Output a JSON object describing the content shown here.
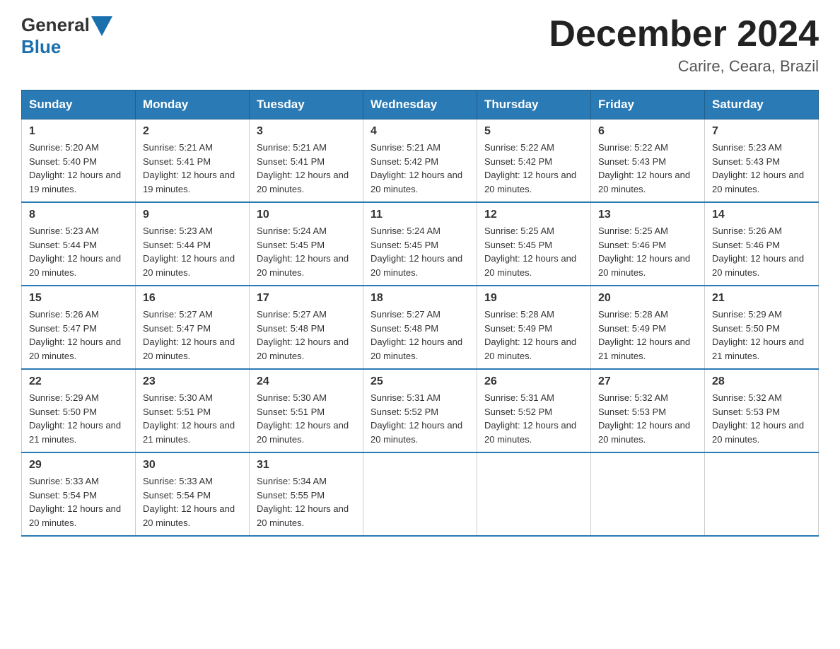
{
  "header": {
    "logo_general": "General",
    "logo_blue": "Blue",
    "month_title": "December 2024",
    "location": "Carire, Ceara, Brazil"
  },
  "days_of_week": [
    "Sunday",
    "Monday",
    "Tuesday",
    "Wednesday",
    "Thursday",
    "Friday",
    "Saturday"
  ],
  "weeks": [
    [
      {
        "day": "1",
        "sunrise": "5:20 AM",
        "sunset": "5:40 PM",
        "daylight": "12 hours and 19 minutes."
      },
      {
        "day": "2",
        "sunrise": "5:21 AM",
        "sunset": "5:41 PM",
        "daylight": "12 hours and 19 minutes."
      },
      {
        "day": "3",
        "sunrise": "5:21 AM",
        "sunset": "5:41 PM",
        "daylight": "12 hours and 20 minutes."
      },
      {
        "day": "4",
        "sunrise": "5:21 AM",
        "sunset": "5:42 PM",
        "daylight": "12 hours and 20 minutes."
      },
      {
        "day": "5",
        "sunrise": "5:22 AM",
        "sunset": "5:42 PM",
        "daylight": "12 hours and 20 minutes."
      },
      {
        "day": "6",
        "sunrise": "5:22 AM",
        "sunset": "5:43 PM",
        "daylight": "12 hours and 20 minutes."
      },
      {
        "day": "7",
        "sunrise": "5:23 AM",
        "sunset": "5:43 PM",
        "daylight": "12 hours and 20 minutes."
      }
    ],
    [
      {
        "day": "8",
        "sunrise": "5:23 AM",
        "sunset": "5:44 PM",
        "daylight": "12 hours and 20 minutes."
      },
      {
        "day": "9",
        "sunrise": "5:23 AM",
        "sunset": "5:44 PM",
        "daylight": "12 hours and 20 minutes."
      },
      {
        "day": "10",
        "sunrise": "5:24 AM",
        "sunset": "5:45 PM",
        "daylight": "12 hours and 20 minutes."
      },
      {
        "day": "11",
        "sunrise": "5:24 AM",
        "sunset": "5:45 PM",
        "daylight": "12 hours and 20 minutes."
      },
      {
        "day": "12",
        "sunrise": "5:25 AM",
        "sunset": "5:45 PM",
        "daylight": "12 hours and 20 minutes."
      },
      {
        "day": "13",
        "sunrise": "5:25 AM",
        "sunset": "5:46 PM",
        "daylight": "12 hours and 20 minutes."
      },
      {
        "day": "14",
        "sunrise": "5:26 AM",
        "sunset": "5:46 PM",
        "daylight": "12 hours and 20 minutes."
      }
    ],
    [
      {
        "day": "15",
        "sunrise": "5:26 AM",
        "sunset": "5:47 PM",
        "daylight": "12 hours and 20 minutes."
      },
      {
        "day": "16",
        "sunrise": "5:27 AM",
        "sunset": "5:47 PM",
        "daylight": "12 hours and 20 minutes."
      },
      {
        "day": "17",
        "sunrise": "5:27 AM",
        "sunset": "5:48 PM",
        "daylight": "12 hours and 20 minutes."
      },
      {
        "day": "18",
        "sunrise": "5:27 AM",
        "sunset": "5:48 PM",
        "daylight": "12 hours and 20 minutes."
      },
      {
        "day": "19",
        "sunrise": "5:28 AM",
        "sunset": "5:49 PM",
        "daylight": "12 hours and 20 minutes."
      },
      {
        "day": "20",
        "sunrise": "5:28 AM",
        "sunset": "5:49 PM",
        "daylight": "12 hours and 21 minutes."
      },
      {
        "day": "21",
        "sunrise": "5:29 AM",
        "sunset": "5:50 PM",
        "daylight": "12 hours and 21 minutes."
      }
    ],
    [
      {
        "day": "22",
        "sunrise": "5:29 AM",
        "sunset": "5:50 PM",
        "daylight": "12 hours and 21 minutes."
      },
      {
        "day": "23",
        "sunrise": "5:30 AM",
        "sunset": "5:51 PM",
        "daylight": "12 hours and 21 minutes."
      },
      {
        "day": "24",
        "sunrise": "5:30 AM",
        "sunset": "5:51 PM",
        "daylight": "12 hours and 20 minutes."
      },
      {
        "day": "25",
        "sunrise": "5:31 AM",
        "sunset": "5:52 PM",
        "daylight": "12 hours and 20 minutes."
      },
      {
        "day": "26",
        "sunrise": "5:31 AM",
        "sunset": "5:52 PM",
        "daylight": "12 hours and 20 minutes."
      },
      {
        "day": "27",
        "sunrise": "5:32 AM",
        "sunset": "5:53 PM",
        "daylight": "12 hours and 20 minutes."
      },
      {
        "day": "28",
        "sunrise": "5:32 AM",
        "sunset": "5:53 PM",
        "daylight": "12 hours and 20 minutes."
      }
    ],
    [
      {
        "day": "29",
        "sunrise": "5:33 AM",
        "sunset": "5:54 PM",
        "daylight": "12 hours and 20 minutes."
      },
      {
        "day": "30",
        "sunrise": "5:33 AM",
        "sunset": "5:54 PM",
        "daylight": "12 hours and 20 minutes."
      },
      {
        "day": "31",
        "sunrise": "5:34 AM",
        "sunset": "5:55 PM",
        "daylight": "12 hours and 20 minutes."
      },
      null,
      null,
      null,
      null
    ]
  ]
}
